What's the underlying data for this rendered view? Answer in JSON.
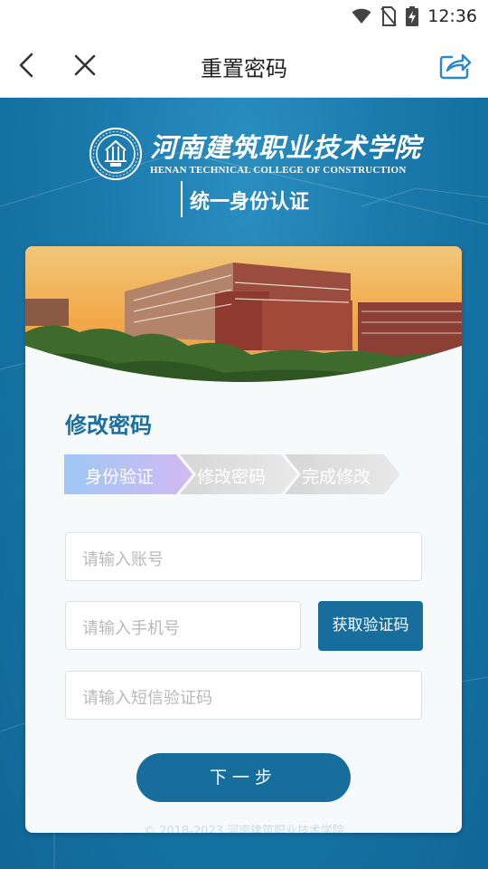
{
  "status_bar": {
    "time": "12:36",
    "icons": [
      "wifi-icon",
      "no-sim-icon",
      "battery-charging-icon"
    ]
  },
  "nav": {
    "title": "重置密码",
    "back_icon": "chevron-left-icon",
    "close_icon": "close-icon",
    "share_icon": "share-icon"
  },
  "header": {
    "school_name_cn": "河南建筑职业技术学院",
    "school_name_en": "HENAN TECHNICAL COLLEGE OF CONSTRUCTION",
    "subtitle": "统一身份认证"
  },
  "form": {
    "heading": "修改密码",
    "steps": [
      {
        "label": "身份验证",
        "active": true
      },
      {
        "label": "修改密码",
        "active": false
      },
      {
        "label": "完成修改",
        "active": false
      }
    ],
    "account_placeholder": "请输入账号",
    "phone_placeholder": "请输入手机号",
    "sms_placeholder": "请输入短信验证码",
    "get_code_label": "获取验证码",
    "next_label": "下一步"
  },
  "footer": {
    "copyright": "© 2018-2023 河南建筑职业技术学院"
  },
  "colors": {
    "primary": "#176e9d",
    "background": "#1a78ab",
    "step_active": "#a9c8f5",
    "step_inactive": "#d9d9d9"
  }
}
